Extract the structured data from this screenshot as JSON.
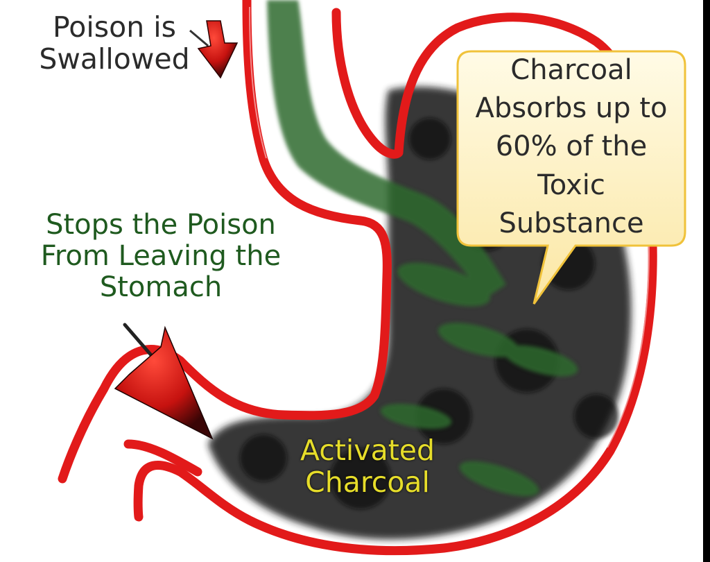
{
  "labels": {
    "swallowed": [
      "Poison is",
      "Swallowed"
    ],
    "absorbs": [
      "Charcoal",
      "Absorbs up to",
      "60% of the",
      "Toxic",
      "Substance"
    ],
    "stops": [
      "Stops the Poison",
      "From Leaving the",
      "Stomach"
    ],
    "charcoal": [
      "Activated",
      "Charcoal"
    ]
  },
  "colors": {
    "stomach_outline": "#e21a1a",
    "charcoal": "#1a1a1a",
    "poison": "#2f6b2f",
    "callout_fill": "#fff6cf",
    "callout_border": "#f0c23a",
    "arrow": "#d11b1b",
    "charcoal_text": "#e6dd2a",
    "stops_text": "#1f5a1f"
  },
  "icons": [
    "down-arrow-icon",
    "diagonal-arrow-icon"
  ]
}
